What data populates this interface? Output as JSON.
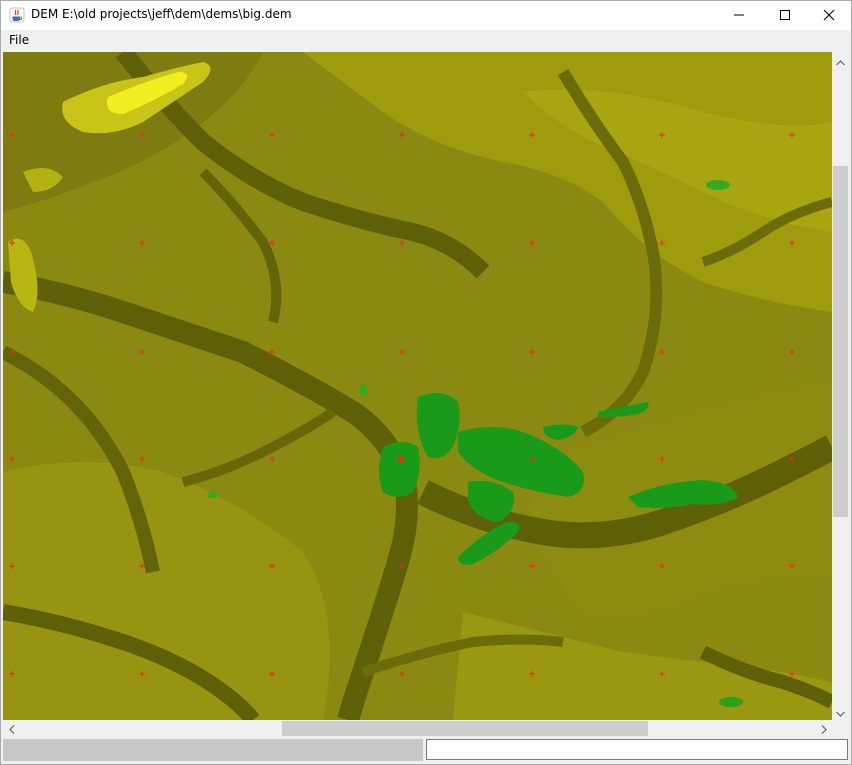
{
  "window": {
    "title": "DEM E:\\old projects\\jeff\\dem\\dems\\big.dem",
    "app_icon": "java-icon",
    "caption_buttons": {
      "minimize_icon": "minimize-icon",
      "maximize_icon": "maximize-icon",
      "close_icon": "close-icon"
    }
  },
  "menubar": {
    "items": [
      {
        "label": "File"
      }
    ]
  },
  "map": {
    "description_colors": {
      "lowland": "#5e6008",
      "midland": "#8a8a12",
      "upland": "#9e9c0c",
      "highland": "#b0ae10",
      "peak": "#f0f020",
      "depression": "#1a9a1a",
      "grid_marker": "#ff2020"
    },
    "grid_marker_icon": "plus-marker-icon"
  },
  "scrollbars": {
    "vertical": {
      "up_icon": "arrow-up-icon",
      "down_icon": "arrow-down-icon",
      "position": 0.17,
      "visible_fraction": 0.53
    },
    "horizontal": {
      "left_icon": "arrow-left-icon",
      "right_icon": "arrow-right-icon",
      "position": 0.34,
      "visible_fraction": 0.44
    }
  },
  "statusbar": {
    "field_value": ""
  }
}
